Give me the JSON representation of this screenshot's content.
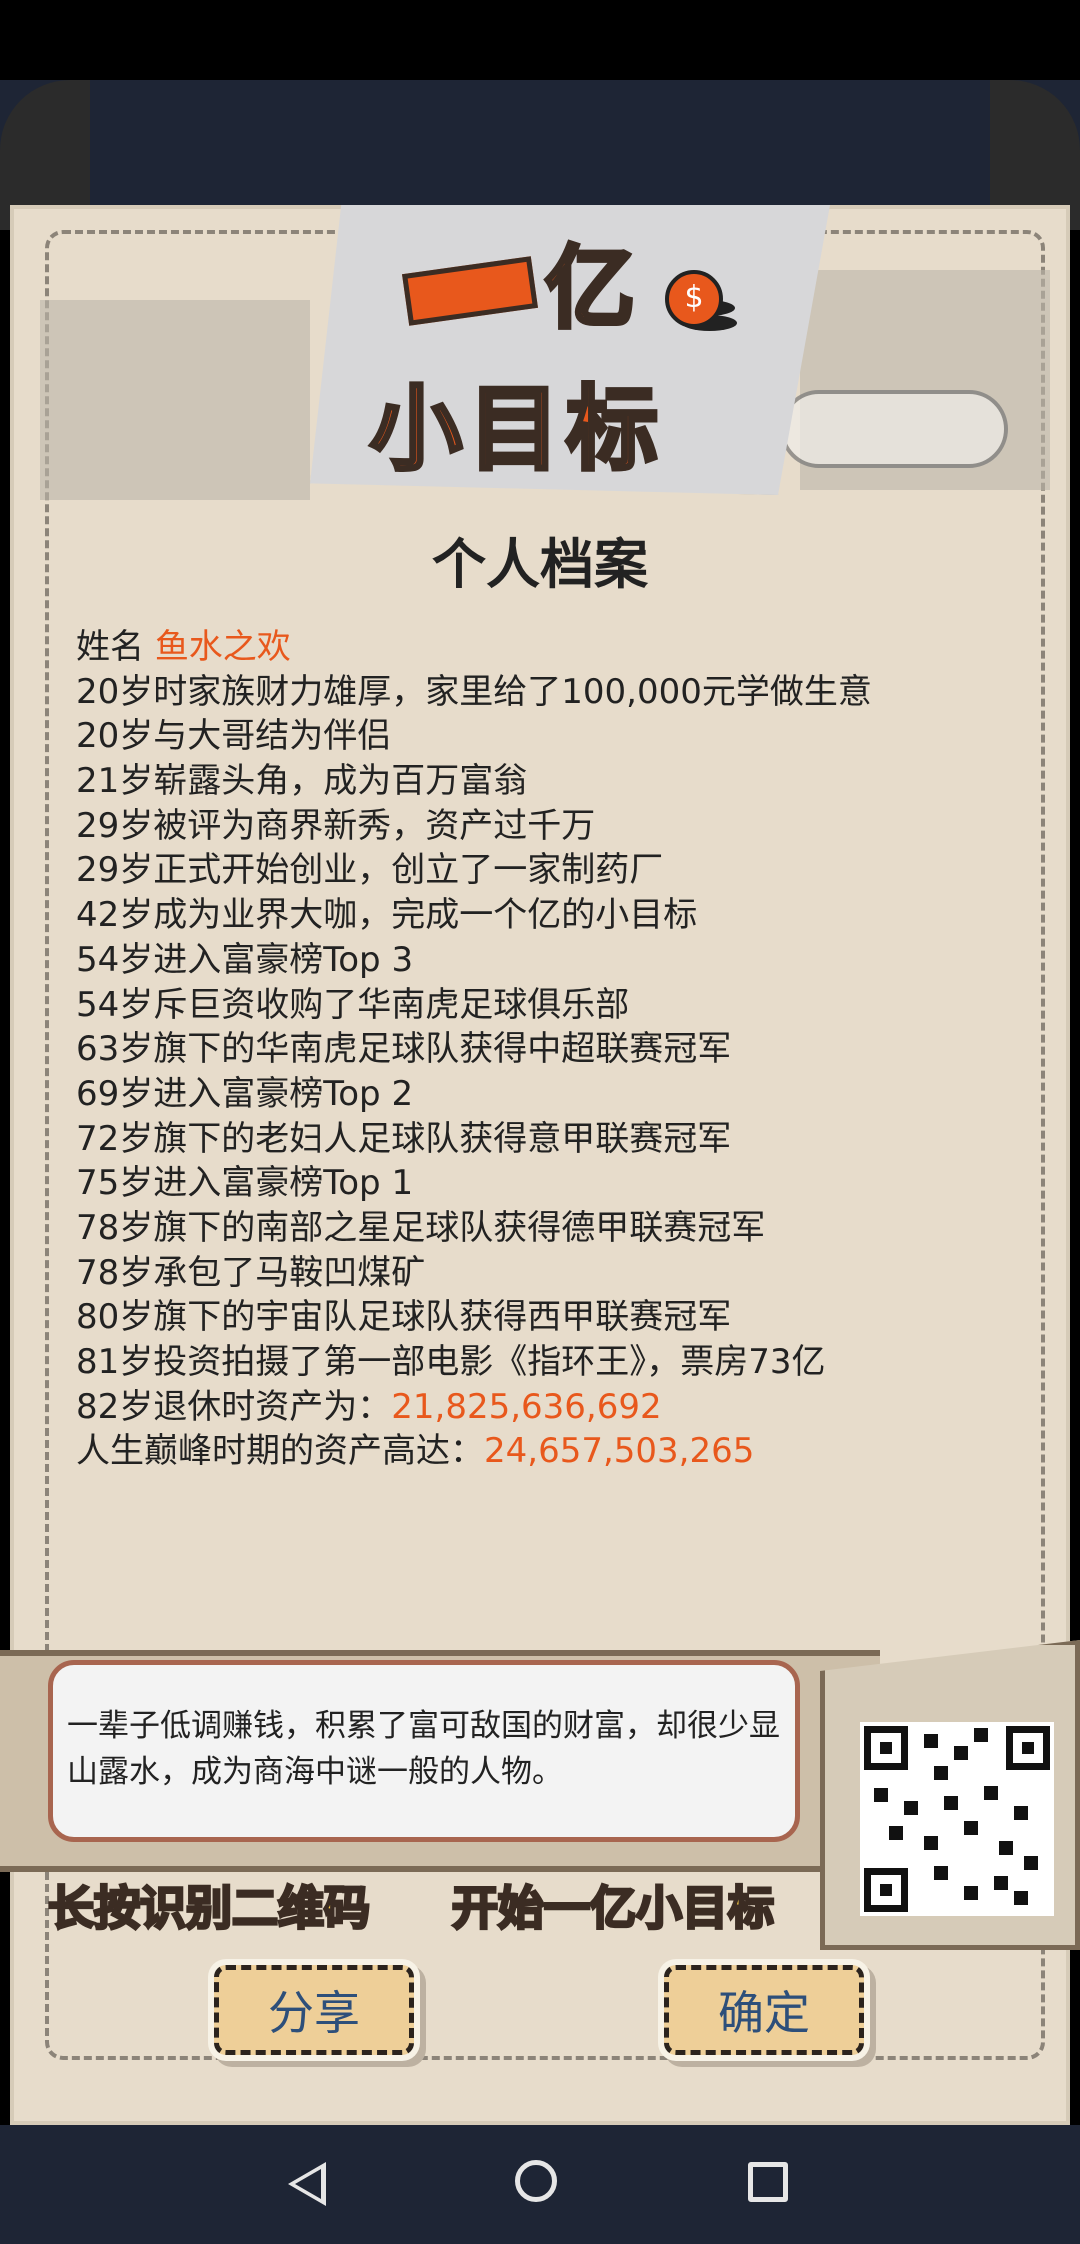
{
  "logo": {
    "yi_char": "亿",
    "title": "小目标",
    "coin_symbol": "$"
  },
  "page_title": "个人档案",
  "profile": {
    "name_label": "姓名",
    "name_value": "鱼水之欢",
    "events": [
      "20岁时家族财力雄厚，家里给了100,000元学做生意",
      "20岁与大哥结为伴侣",
      "21岁崭露头角，成为百万富翁",
      "29岁被评为商界新秀，资产过千万",
      "29岁正式开始创业，创立了一家制药厂",
      "42岁成为业界大咖，完成一个亿的小目标",
      "54岁进入富豪榜Top 3",
      "54岁斥巨资收购了华南虎足球俱乐部",
      "63岁旗下的华南虎足球队获得中超联赛冠军",
      "69岁进入富豪榜Top 2",
      "72岁旗下的老妇人足球队获得意甲联赛冠军",
      "75岁进入富豪榜Top 1",
      "78岁旗下的南部之星足球队获得德甲联赛冠军",
      "78岁承包了马鞍凹煤矿",
      "80岁旗下的宇宙队足球队获得西甲联赛冠军",
      "81岁投资拍摄了第一部电影《指环王》，票房73亿"
    ],
    "retire_label": "82岁退休时资产为：",
    "retire_value": "21,825,636,692",
    "peak_label": "人生巅峰时期的资产高达：",
    "peak_value": "24,657,503,265"
  },
  "summary": "一辈子低调赚钱，积累了富可敌国的财富，却很少显山露水，成为商海中谜一般的人物。",
  "cta": {
    "left": "长按识别二维码",
    "right": "开始一亿小目标"
  },
  "buttons": {
    "share": "分享",
    "confirm": "确定"
  },
  "colors": {
    "accent": "#e8581c",
    "paper": "#e7dccb",
    "button": "#eecf98",
    "cta": "#f4c845"
  }
}
